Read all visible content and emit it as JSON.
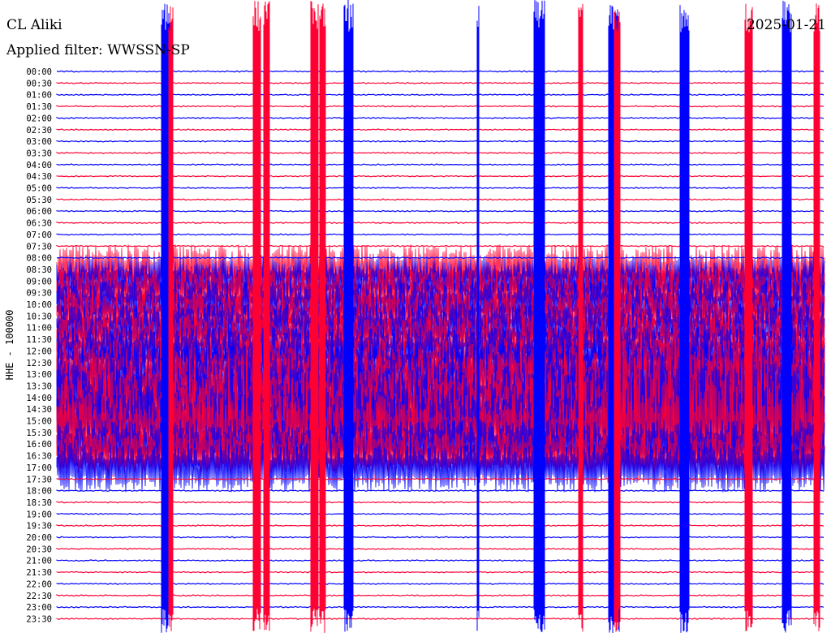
{
  "header": {
    "station": "CL Aliki",
    "filter": "Applied filter: WWSSN-SP",
    "date": "2025-01-21"
  },
  "chart_data": {
    "type": "line",
    "title": "CL Aliki",
    "ylabel": "HHE - 100000",
    "row_labels": [
      "00:00",
      "00:30",
      "01:00",
      "01:30",
      "02:00",
      "02:30",
      "03:00",
      "03:30",
      "04:00",
      "04:30",
      "05:00",
      "05:30",
      "06:00",
      "06:30",
      "07:00",
      "07:30",
      "08:00",
      "08:30",
      "09:00",
      "09:30",
      "10:00",
      "10:30",
      "11:00",
      "11:30",
      "12:00",
      "12:30",
      "13:00",
      "13:30",
      "14:00",
      "14:30",
      "15:00",
      "15:30",
      "16:00",
      "16:30",
      "17:00",
      "17:30",
      "18:00",
      "18:30",
      "19:00",
      "19:30",
      "20:00",
      "20:30",
      "21:00",
      "21:30",
      "22:00",
      "22:30",
      "23:00",
      "23:30"
    ],
    "series_colors": [
      "#0000ff",
      "#ff0033"
    ],
    "noisy_rows": [
      "08:30",
      "09:00",
      "09:30",
      "10:00",
      "10:30",
      "11:00",
      "11:30",
      "12:00",
      "12:30",
      "13:00",
      "13:30",
      "14:00",
      "14:30",
      "15:00",
      "15:30",
      "16:00",
      "16:30",
      "17:00"
    ],
    "noise_change_fraction": 0.71,
    "grid": false
  }
}
